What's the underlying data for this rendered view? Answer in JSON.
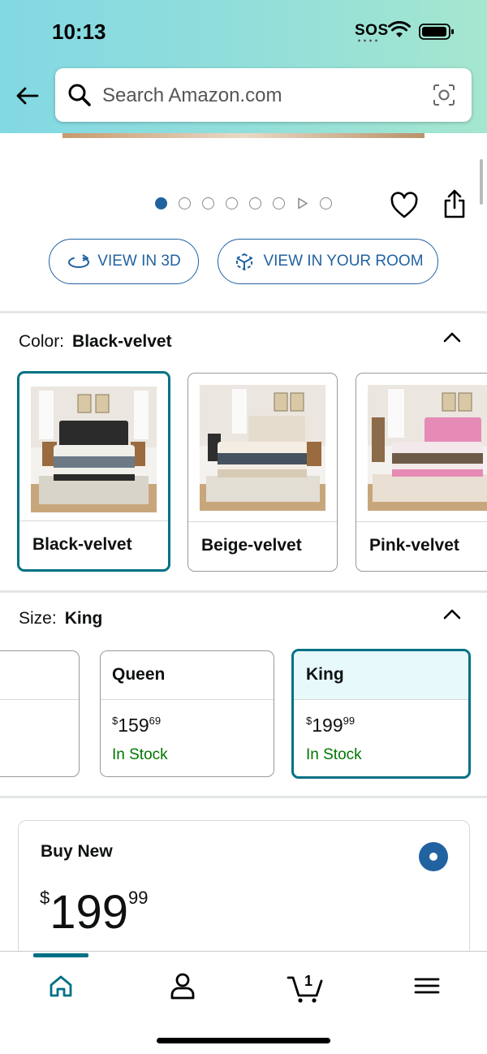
{
  "status_bar": {
    "time": "10:13",
    "sos": "SOS"
  },
  "header": {
    "search_placeholder": "Search Amazon.com"
  },
  "carousel": {
    "dot_count": 8,
    "active_index": 0,
    "video_index": 6
  },
  "actions": {
    "view_3d_label": "VIEW IN 3D",
    "view_room_label": "VIEW IN YOUR ROOM"
  },
  "color": {
    "label": "Color:",
    "selected": "Black-velvet",
    "options": [
      {
        "label": "Black-velvet",
        "headboard": "#2b2b2b",
        "accent": "#f0efe9"
      },
      {
        "label": "Beige-velvet",
        "headboard": "#e6dccd",
        "accent": "#f3ede3"
      },
      {
        "label": "Pink-velvet",
        "headboard": "#e58bb6",
        "accent": "#f3e8ea"
      }
    ]
  },
  "size": {
    "label": "Size:",
    "selected": "King",
    "options": [
      {
        "name": "Queen",
        "price_whole": "159",
        "price_fraction": "69",
        "currency": "$",
        "stock": "In Stock"
      },
      {
        "name": "King",
        "price_whole": "199",
        "price_fraction": "99",
        "currency": "$",
        "stock": "In Stock"
      }
    ]
  },
  "buy": {
    "title": "Buy New",
    "currency": "$",
    "price_whole": "199",
    "price_fraction": "99"
  },
  "bottom_nav": {
    "items": [
      "home-icon",
      "account-icon",
      "cart-icon",
      "menu-icon"
    ],
    "cart_count": "1"
  },
  "colors": {
    "accent": "#007185",
    "link": "#2162a1",
    "in_stock": "#007600"
  }
}
